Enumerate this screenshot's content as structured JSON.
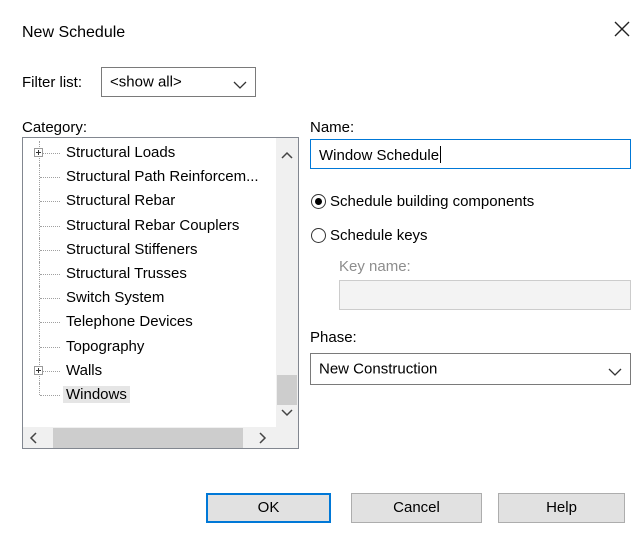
{
  "window": {
    "title": "New Schedule"
  },
  "filter": {
    "label": "Filter list:",
    "value": "<show all>"
  },
  "category": {
    "label": "Category:",
    "items": [
      {
        "label": "Structural Loads",
        "expandable": true
      },
      {
        "label": "Structural Path Reinforcem...",
        "expandable": false
      },
      {
        "label": "Structural Rebar",
        "expandable": false
      },
      {
        "label": "Structural Rebar Couplers",
        "expandable": false
      },
      {
        "label": "Structural Stiffeners",
        "expandable": false
      },
      {
        "label": "Structural Trusses",
        "expandable": false
      },
      {
        "label": "Switch System",
        "expandable": false
      },
      {
        "label": "Telephone Devices",
        "expandable": false
      },
      {
        "label": "Topography",
        "expandable": false
      },
      {
        "label": "Walls",
        "expandable": true
      },
      {
        "label": "Windows",
        "expandable": false,
        "selected": true
      }
    ]
  },
  "name": {
    "label": "Name:",
    "value": "Window Schedule"
  },
  "schedule_type": {
    "options": [
      {
        "label": "Schedule building components",
        "selected": true
      },
      {
        "label": "Schedule keys",
        "selected": false
      }
    ]
  },
  "key_name": {
    "label": "Key name:",
    "value": ""
  },
  "phase": {
    "label": "Phase:",
    "value": "New Construction"
  },
  "buttons": {
    "ok": "OK",
    "cancel": "Cancel",
    "help": "Help"
  },
  "colors": {
    "accent": "#0078d7",
    "button_bg": "#e1e1e1",
    "selection_bg": "#e5e5e5"
  }
}
